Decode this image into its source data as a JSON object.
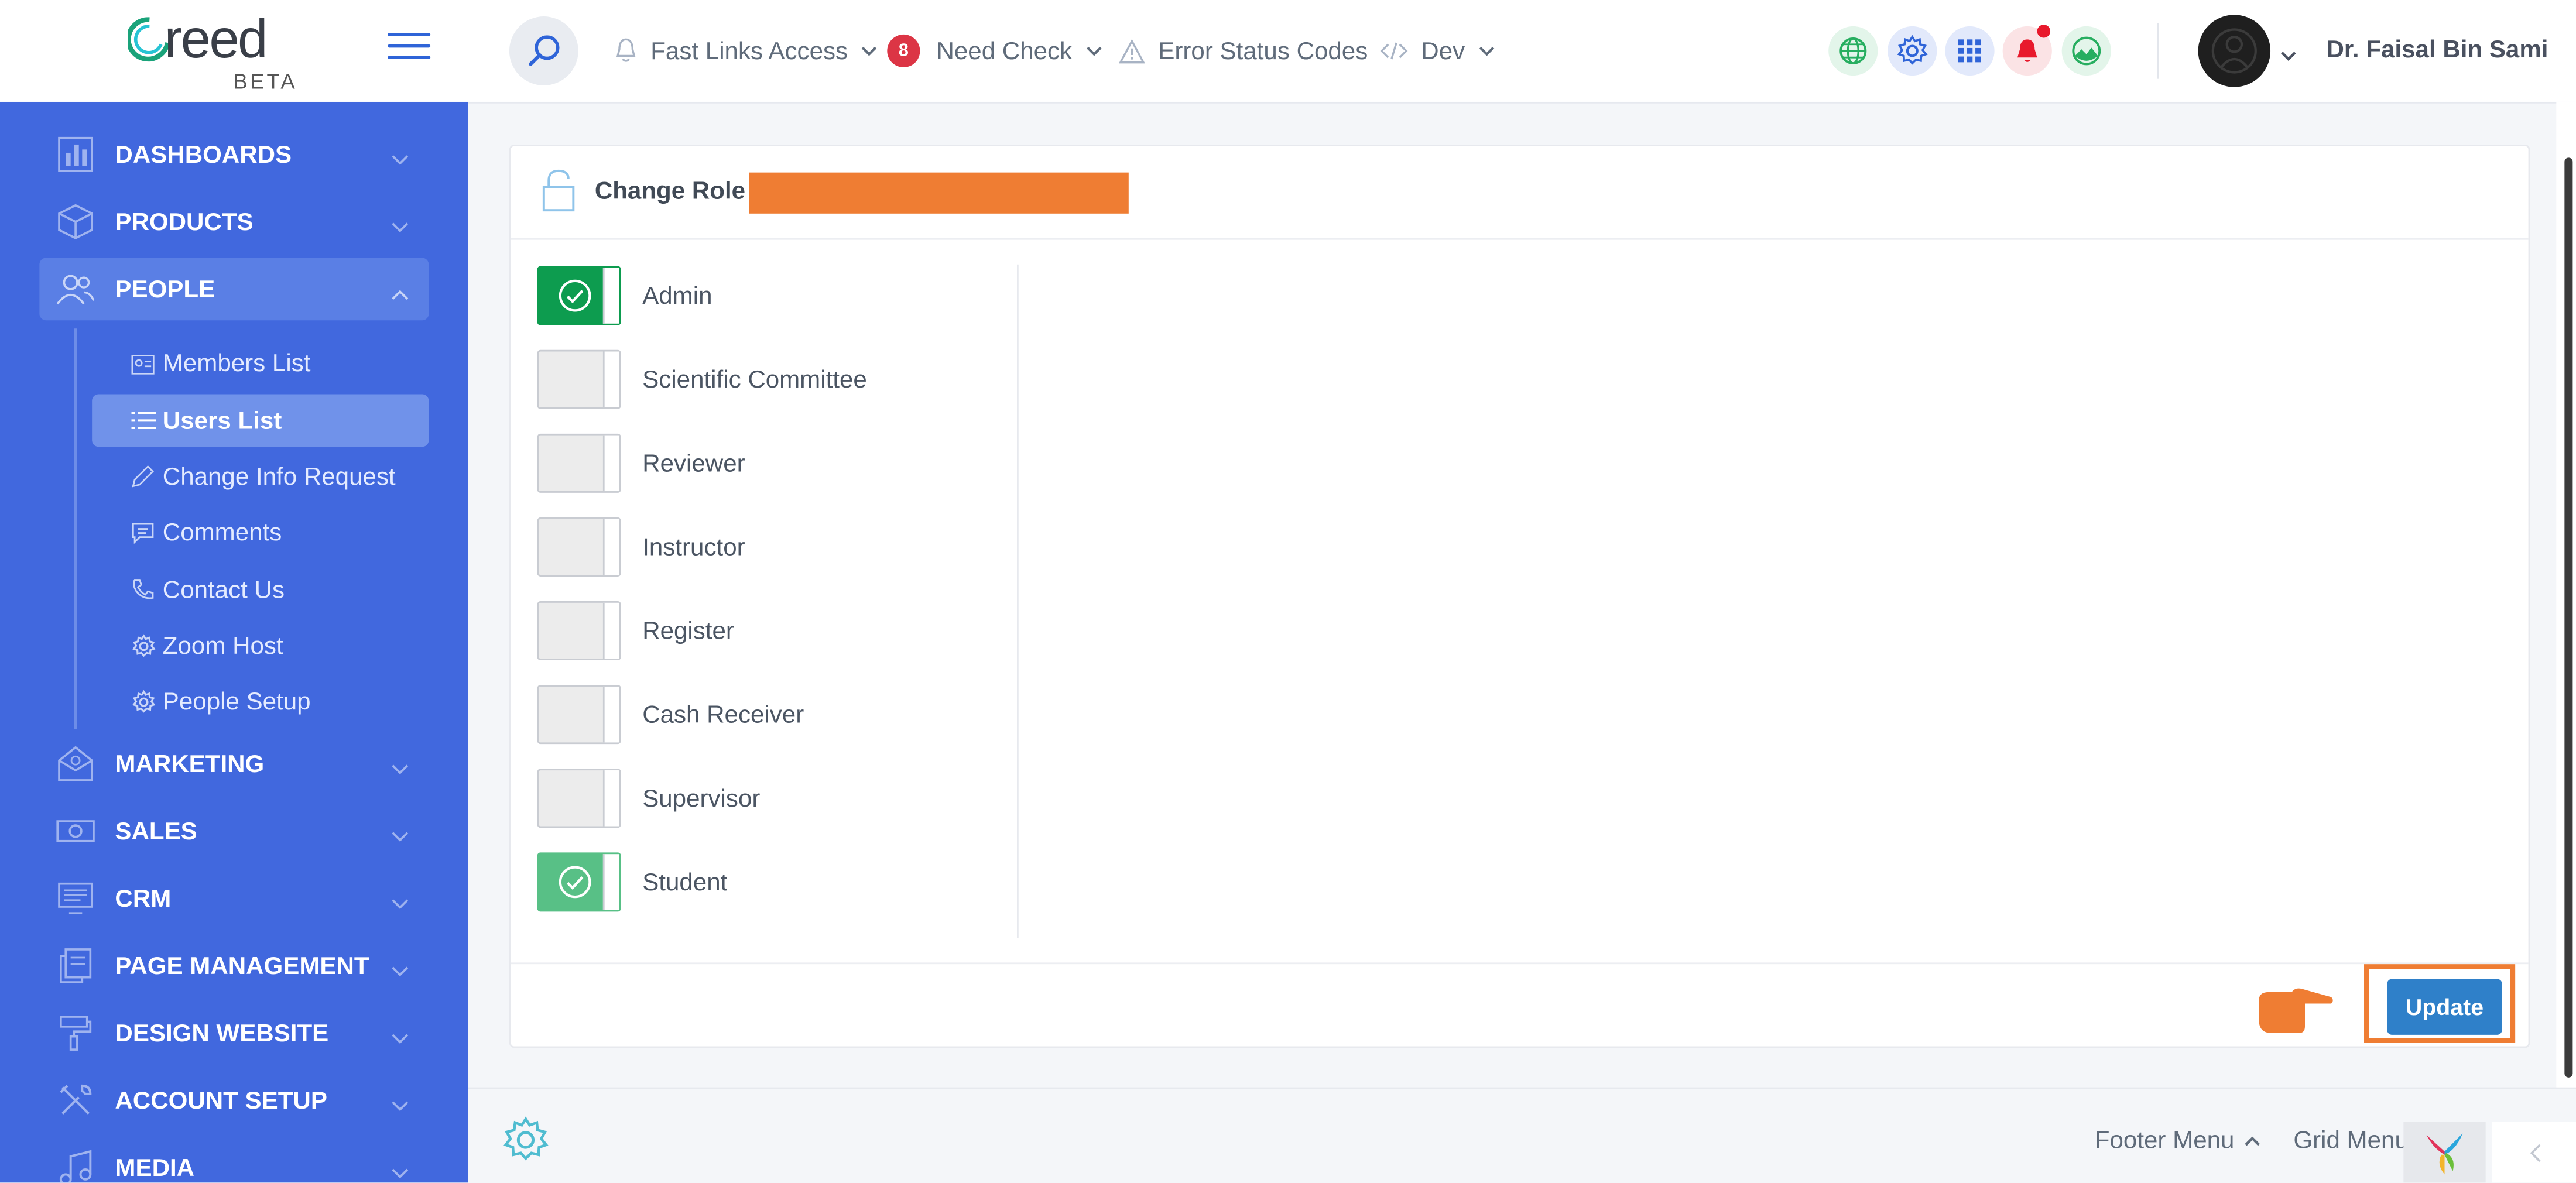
{
  "brand": {
    "logo_text": "reed",
    "logo_sub": "BETA"
  },
  "topbar": {
    "fast_links": "Fast Links Access",
    "need_check_count": "8",
    "need_check": "Need Check",
    "error_codes": "Error Status Codes",
    "dev": "Dev",
    "user_name": "Dr. Faisal Bin Sami"
  },
  "sidebar": {
    "items": [
      {
        "label": "DASHBOARDS",
        "icon": "bar-chart-icon"
      },
      {
        "label": "PRODUCTS",
        "icon": "box-icon"
      },
      {
        "label": "PEOPLE",
        "icon": "people-icon"
      },
      {
        "label": "MARKETING",
        "icon": "megaphone-icon"
      },
      {
        "label": "SALES",
        "icon": "cash-icon"
      },
      {
        "label": "CRM",
        "icon": "monitor-icon"
      },
      {
        "label": "PAGE MANAGEMENT",
        "icon": "pages-icon"
      },
      {
        "label": "DESIGN WEBSITE",
        "icon": "paint-roller-icon"
      },
      {
        "label": "ACCOUNT SETUP",
        "icon": "tools-icon"
      },
      {
        "label": "MEDIA",
        "icon": "music-note-icon"
      }
    ],
    "people_sub": [
      {
        "label": "Members List",
        "icon": "id-card-icon"
      },
      {
        "label": "Users List",
        "icon": "list-icon"
      },
      {
        "label": "Change Info Request",
        "icon": "pencil-icon"
      },
      {
        "label": "Comments",
        "icon": "comment-icon"
      },
      {
        "label": "Contact Us",
        "icon": "phone-icon"
      },
      {
        "label": "Zoom Host",
        "icon": "gear-icon"
      },
      {
        "label": "People Setup",
        "icon": "gear-icon"
      }
    ]
  },
  "card": {
    "title": "Change Role :",
    "roles": [
      {
        "label": "Admin",
        "checked": true
      },
      {
        "label": "Scientific Committee",
        "checked": false
      },
      {
        "label": "Reviewer",
        "checked": false
      },
      {
        "label": "Instructor",
        "checked": false
      },
      {
        "label": "Register",
        "checked": false
      },
      {
        "label": "Cash Receiver",
        "checked": false
      },
      {
        "label": "Supervisor",
        "checked": false
      },
      {
        "label": "Student",
        "checked": true
      }
    ],
    "update_label": "Update"
  },
  "footer": {
    "footer_menu": "Footer Menu",
    "grid_menu": "Grid Menu"
  },
  "colors": {
    "sidebar": "#4168de",
    "accent": "#ef7d33",
    "toggle_on": "#0d9c4f",
    "button": "#2f80c9"
  }
}
